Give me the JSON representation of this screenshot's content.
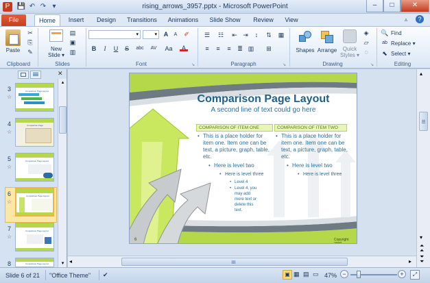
{
  "window": {
    "title": "rising_arrows_3957.pptx  -  Microsoft PowerPoint",
    "minimize": "–",
    "maximize": "□",
    "close": "✕"
  },
  "qat": [
    "P",
    "💾",
    "↶",
    "↷",
    "▾"
  ],
  "tabs": [
    {
      "label": "File"
    },
    {
      "label": "Home"
    },
    {
      "label": "Insert"
    },
    {
      "label": "Design"
    },
    {
      "label": "Transitions"
    },
    {
      "label": "Animations"
    },
    {
      "label": "Slide Show"
    },
    {
      "label": "Review"
    },
    {
      "label": "View"
    }
  ],
  "ribbon": {
    "clipboard": {
      "paste": "Paste",
      "label": "Clipboard"
    },
    "slides": {
      "new_slide": "New",
      "new_slide2": "Slide ▾",
      "label": "Slides"
    },
    "font": {
      "label": "Font",
      "bold": "B",
      "italic": "I",
      "underline": "U",
      "strike": "S",
      "shadow": "abc",
      "spacing": "AV",
      "grow": "A",
      "shrink": "A",
      "case": "Aa",
      "color": "A"
    },
    "paragraph": {
      "label": "Paragraph"
    },
    "drawing": {
      "shapes": "Shapes",
      "arrange": "Arrange",
      "quick_styles": "Quick",
      "quick_styles2": "Styles ▾",
      "label": "Drawing"
    },
    "editing": {
      "find": "Find",
      "replace": "Replace ▾",
      "select": "Select ▾",
      "label": "Editing"
    }
  },
  "thumbnails": [
    {
      "num": "3",
      "title": "Comparison Page Layout"
    },
    {
      "num": "4",
      "title": "Comparison Page"
    },
    {
      "num": "5",
      "title": "Comparison Page Layout"
    },
    {
      "num": "6",
      "title": "Comparison Page Layout"
    },
    {
      "num": "7",
      "title": "Comparison Page Layout"
    },
    {
      "num": "8",
      "title": "Comparison Page Layout"
    }
  ],
  "slide": {
    "title": "Comparison Page Layout",
    "subtitle": "A second line of text could go here",
    "col1_header": "COMPARISON  OF  ITEM ONE",
    "col2_header": "COMPARISON  OF  ITEM TWO",
    "col1_body": "This is a place holder for item one.  Item one can be text, a picture, graph, table, etc.",
    "col2_body": "This is a place holder for item one.  Item one can be text, a picture, graph, table, etc.",
    "col1_level2": "Here is level two",
    "col2_level2": "Here is level two",
    "col1_level3": "Here is level three",
    "col2_level3": "Here is level three",
    "col1_level4a": "Level 4",
    "col1_level4b": "Level 4, you may add more text or delete this text.",
    "page_num": "6",
    "copyright": "Copyright 2009",
    "colors": {
      "accent_green": "#b4d84a",
      "title_blue": "#1f5f8b",
      "body_blue": "#2a6f9a",
      "header_bg": "#e9f5b8"
    }
  },
  "status": {
    "slide_info": "Slide 6 of 21",
    "theme": "\"Office Theme\"",
    "zoom": "47%",
    "minus": "−",
    "plus": "+"
  }
}
